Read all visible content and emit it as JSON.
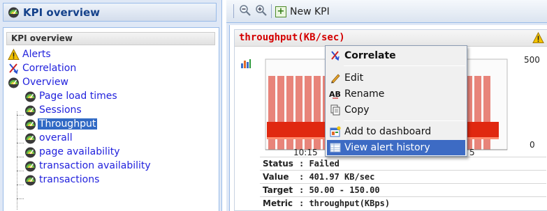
{
  "left_panel": {
    "header_title": "KPI overview",
    "tree_title": "KPI overview",
    "items": [
      {
        "label": "Alerts",
        "icon": "warning-icon"
      },
      {
        "label": "Correlation",
        "icon": "correlation-icon"
      },
      {
        "label": "Overview",
        "icon": "gauge-icon"
      },
      {
        "label": "Page load times",
        "icon": "gauge-icon"
      },
      {
        "label": "Sessions",
        "icon": "gauge-icon"
      },
      {
        "label": "Throughput",
        "icon": "gauge-icon",
        "selected": true
      },
      {
        "label": "overall",
        "icon": "gauge-icon"
      },
      {
        "label": "page availability",
        "icon": "gauge-icon"
      },
      {
        "label": "transaction availability",
        "icon": "gauge-icon"
      },
      {
        "label": "transactions",
        "icon": "gauge-icon"
      }
    ]
  },
  "toolbar": {
    "zoom_out_icon": "zoom-out-icon",
    "zoom_in_icon": "zoom-in-icon",
    "new_kpi_label": "New KPI"
  },
  "kpi": {
    "title": "throughput(KB/sec)",
    "y_tick_top": "500",
    "y_tick_bottom": "0",
    "x_tick_left": "10:15",
    "x_tick_right": "5",
    "status_key": "Status",
    "status_value": ": Failed",
    "value_key": "Value",
    "value_value": ": 401.97 KB/sec",
    "target_key": "Target",
    "target_value": ": 50.00 - 150.00",
    "metric_key": "Metric",
    "metric_value": ": throughput(KBps)"
  },
  "context_menu": {
    "items": [
      {
        "label": "Correlate",
        "icon": "correlate-icon"
      },
      {
        "label": "Edit",
        "icon": "pencil-icon"
      },
      {
        "label": "Rename",
        "icon": "rename-icon"
      },
      {
        "label": "Copy",
        "icon": "copy-icon"
      },
      {
        "label": "Add to dashboard",
        "icon": "dashboard-icon"
      },
      {
        "label": "View alert history",
        "icon": "table-icon"
      }
    ]
  },
  "colors": {
    "accent": "#15428b",
    "bar_fill": "#e8847a",
    "bar_alert": "#e02810",
    "highlight": "#3d6bc4",
    "title_red": "#d40000"
  }
}
